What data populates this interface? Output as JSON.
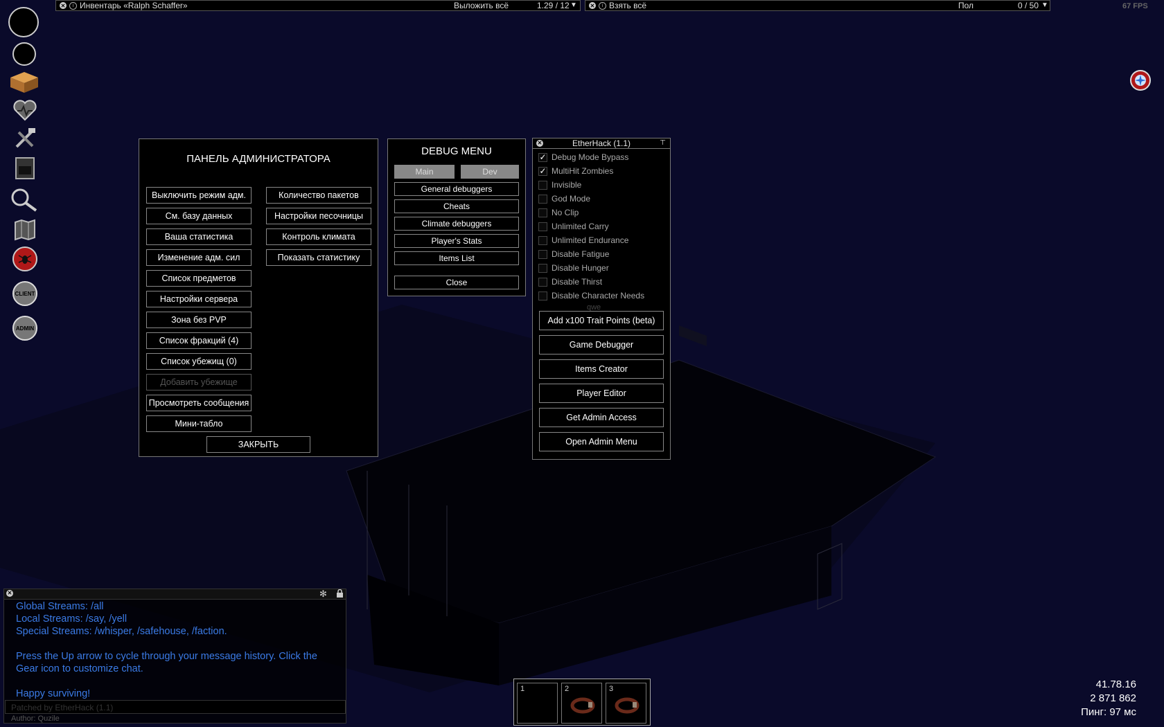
{
  "colors": {
    "background": "#0a0a2a",
    "chat_text": "#3b7be6",
    "accent_red": "#b01818"
  },
  "fps": "67 FPS",
  "inventory_bar": {
    "title": "Инвентарь «Ralph Schaffer»",
    "action": "Выложить всё",
    "weight": "1.29 / 12"
  },
  "loot_bar": {
    "title": "Взять всё",
    "location": "Пол",
    "weight": "0 / 50"
  },
  "sidebar": [
    {
      "name": "health-circle-icon"
    },
    {
      "name": "stats-circle-icon"
    },
    {
      "name": "inventory-box-icon"
    },
    {
      "name": "health-heart-icon"
    },
    {
      "name": "crafting-tools-icon"
    },
    {
      "name": "furnace-icon"
    },
    {
      "name": "search-magnifier-icon"
    },
    {
      "name": "map-icon"
    },
    {
      "name": "zombie-spider-icon"
    },
    {
      "name": "client-icon",
      "label": "CLIENT"
    },
    {
      "name": "admin-icon",
      "label": "ADMIN"
    }
  ],
  "admin_panel": {
    "title": "ПАНЕЛЬ АДМИНИСТРАТОРА",
    "left_buttons": [
      "Выключить режим адм.",
      "См. базу данных",
      "Ваша статистика",
      "Изменение адм. сил",
      "Список предметов",
      "Настройки сервера",
      "Зона без PVP",
      "Список фракций (4)",
      "Список убежищ (0)",
      "Добавить убежище",
      "Просмотреть сообщения",
      "Мини-табло"
    ],
    "right_buttons": [
      "Количество пакетов",
      "Настройки песочницы",
      "Контроль климата",
      "Показать статистику"
    ],
    "close": "ЗАКРЫТЬ"
  },
  "debug_menu": {
    "title": "DEBUG MENU",
    "tab_main": "Main",
    "tab_dev": "Dev",
    "buttons": [
      "General debuggers",
      "Cheats",
      "Climate debuggers",
      "Player's Stats",
      "Items List"
    ],
    "close": "Close"
  },
  "etherhack": {
    "title": "EtherHack (1.1)",
    "options": [
      {
        "label": "Debug Mode Bypass",
        "checked": true
      },
      {
        "label": "MultiHit Zombies",
        "checked": true
      },
      {
        "label": "Invisible",
        "checked": false
      },
      {
        "label": "God Mode",
        "checked": false
      },
      {
        "label": "No Clip",
        "checked": false
      },
      {
        "label": "Unlimited Carry",
        "checked": false
      },
      {
        "label": "Unlimited Endurance",
        "checked": false
      },
      {
        "label": "Disable Fatigue",
        "checked": false
      },
      {
        "label": "Disable Hunger",
        "checked": false
      },
      {
        "label": "Disable Thirst",
        "checked": false
      },
      {
        "label": "Disable Character Needs",
        "checked": false
      }
    ],
    "check_mark": "✓",
    "partial_text": "qwe",
    "buttons": [
      "Add x100 Trait Points (beta)",
      "Game Debugger",
      "Items Creator",
      "Player Editor",
      "Get Admin Access",
      "Open Admin Menu"
    ]
  },
  "chat": {
    "lines": [
      "Global Streams: /all",
      "Local Streams: /say, /yell",
      "Special Streams: /whisper, /safehouse, /faction.",
      "",
      "Press the Up arrow to cycle through your message history. Click the",
      "Gear icon to customize chat.",
      "",
      "Happy surviving!"
    ],
    "input_overlay": "Patched by EtherHack (1.1)",
    "author": "Author: Quzile"
  },
  "hotbar": {
    "slots": [
      "1",
      "2",
      "3"
    ]
  },
  "stats": {
    "ip": "41.78.16",
    "count": "2 871 862",
    "ping": "Пинг: 97 мс"
  }
}
